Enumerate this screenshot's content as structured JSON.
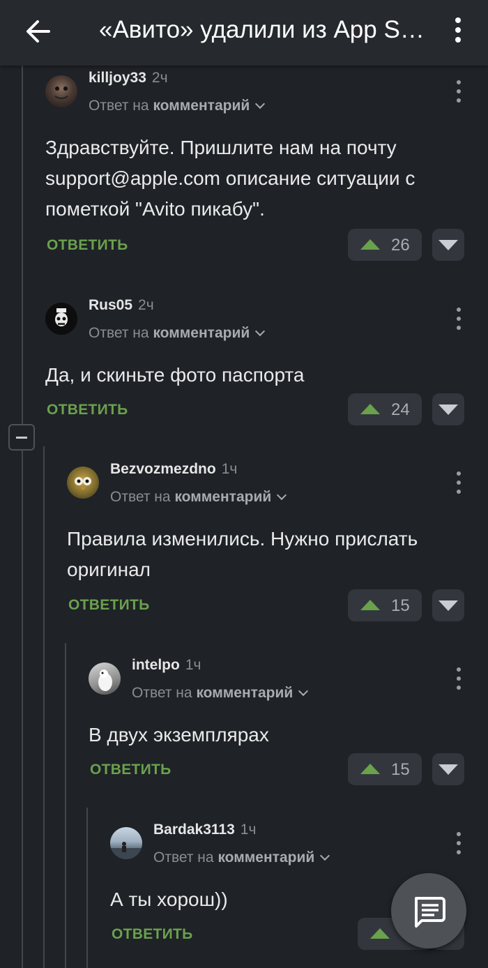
{
  "appbar": {
    "title": "«Авито» удалили из App Store"
  },
  "common": {
    "reply_to_prefix": "Ответ на",
    "reply_to_target": "комментарий",
    "reply_label": "ОТВЕТИТЬ"
  },
  "comments": [
    {
      "user": "killjoy33",
      "time": "2ч",
      "text": "Здравствуйте. Пришлите нам на почту support@apple.com описание ситуации с пометкой \"Avito пикабу\".",
      "votes": "26"
    },
    {
      "user": "Rus05",
      "time": "2ч",
      "text": "Да, и скиньте фото паспорта",
      "votes": "24"
    },
    {
      "user": "Bezvozmezdno",
      "time": "1ч",
      "text": "Правила изменились. Нужно прислать оригинал",
      "votes": "15"
    },
    {
      "user": "intelpo",
      "time": "1ч",
      "text": "В двух экземплярах",
      "votes": "15"
    },
    {
      "user": "Bardak3113",
      "time": "1ч",
      "text": "А ты хорош))",
      "votes": ""
    }
  ],
  "colors": {
    "background": "#1f2227",
    "appbar": "#26292e",
    "accent_green": "#6aa14d",
    "vote_button": "#33373d"
  },
  "icons": {
    "back": "arrow-left-icon",
    "more": "more-vertical-icon",
    "collapse": "minus-square-icon",
    "fab": "comment-icon",
    "upvote": "triangle-up-icon",
    "downvote": "triangle-down-icon"
  }
}
